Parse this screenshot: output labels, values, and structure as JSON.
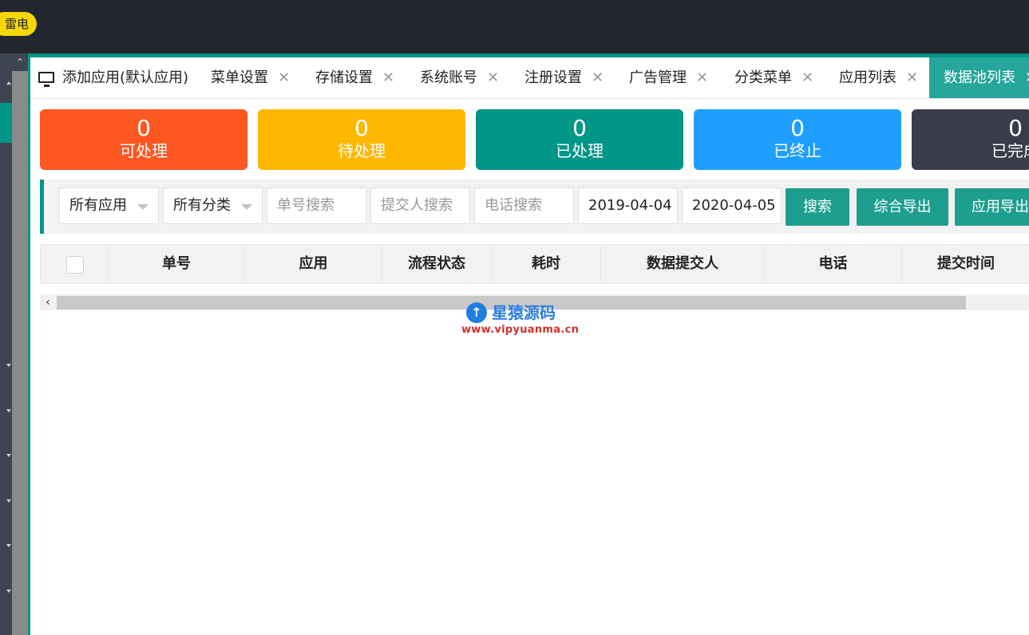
{
  "topbar": {
    "badge": "雷电"
  },
  "tabs": [
    {
      "label": "添加应用(默认应用)",
      "closable": false,
      "icon": "monitor-icon"
    },
    {
      "label": "菜单设置",
      "closable": true
    },
    {
      "label": "存储设置",
      "closable": true
    },
    {
      "label": "系统账号",
      "closable": true
    },
    {
      "label": "注册设置",
      "closable": true
    },
    {
      "label": "广告管理",
      "closable": true
    },
    {
      "label": "分类菜单",
      "closable": true
    },
    {
      "label": "应用列表",
      "closable": true
    },
    {
      "label": "数据池列表",
      "closable": true,
      "active": true
    }
  ],
  "close_glyph": "✕",
  "stats": [
    {
      "value": "0",
      "label": "可处理",
      "color": "#ff5722"
    },
    {
      "value": "0",
      "label": "待处理",
      "color": "#ffb800"
    },
    {
      "value": "0",
      "label": "已处理",
      "color": "#009688"
    },
    {
      "value": "0",
      "label": "已终止",
      "color": "#1e9fff"
    },
    {
      "value": "0",
      "label": "已完成",
      "color": "#393d49"
    }
  ],
  "filters": {
    "app_select": "所有应用",
    "category_select": "所有分类",
    "order_search_placeholder": "单号搜索",
    "submitter_search_placeholder": "提交人搜索",
    "phone_search_placeholder": "电话搜索",
    "date_start": "2019-04-04",
    "date_end": "2020-04-05",
    "search_button": "搜索",
    "export_all_button": "综合导出",
    "export_app_button": "应用导出"
  },
  "table": {
    "columns": [
      "单号",
      "应用",
      "流程状态",
      "耗时",
      "数据提交人",
      "电话",
      "提交时间"
    ]
  },
  "watermark": {
    "name": "星猿源码",
    "url": "www.vipyuanma.cn"
  },
  "colors": {
    "accent": "#009688",
    "topbar": "#23262e"
  }
}
